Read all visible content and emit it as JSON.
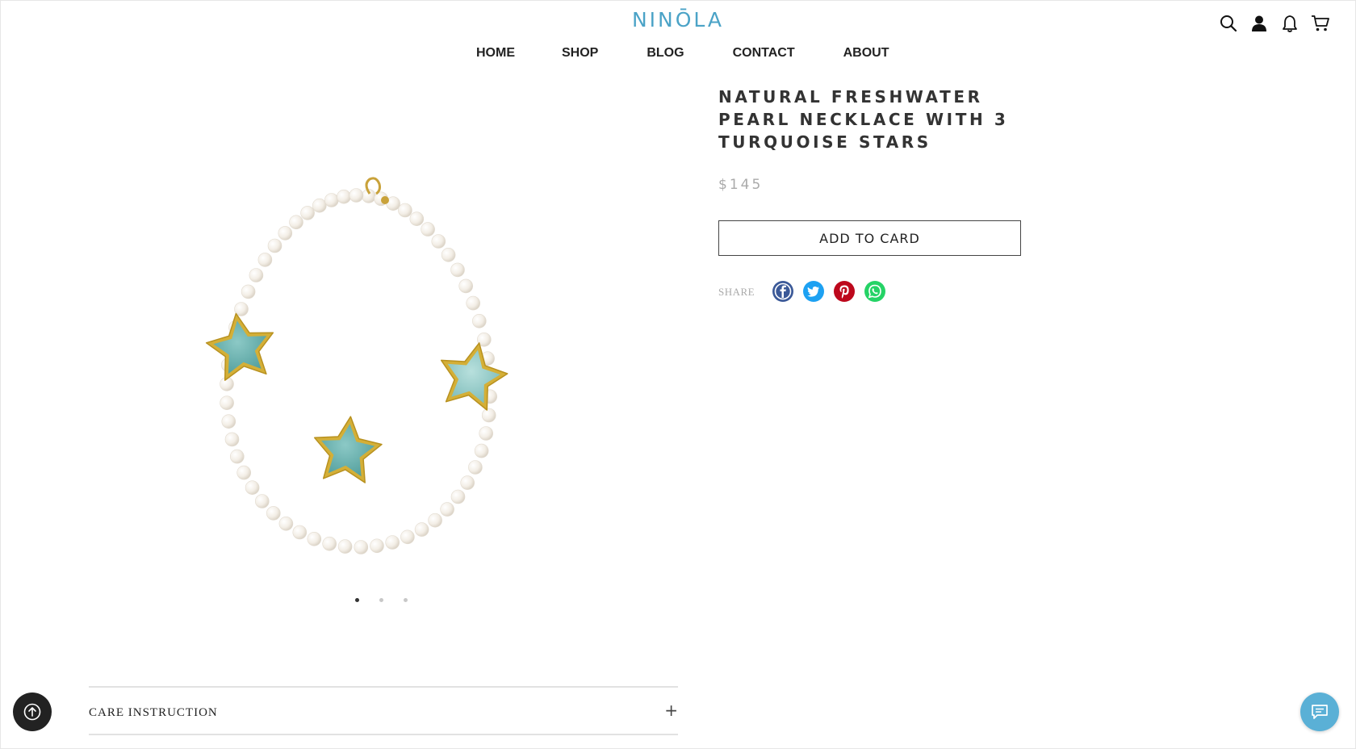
{
  "brand": {
    "logo_text": "NINŌLA",
    "logo_color": "#4ba3c7"
  },
  "nav": {
    "items": [
      {
        "label": "HOME"
      },
      {
        "label": "SHOP"
      },
      {
        "label": "BLOG"
      },
      {
        "label": "CONTACT"
      },
      {
        "label": "ABOUT"
      }
    ]
  },
  "header_icons": [
    "search-icon",
    "user-icon",
    "bell-icon",
    "cart-icon"
  ],
  "product": {
    "title": "NATURAL FRESHWATER PEARL NECKLACE WITH 3 TURQUOISE STARS",
    "price": "$145",
    "add_to_cart_label": "ADD TO CARD",
    "image_count": 3,
    "active_image": 1
  },
  "share": {
    "label": "SHARE",
    "networks": [
      {
        "name": "facebook",
        "color": "#3b5998"
      },
      {
        "name": "twitter",
        "color": "#1da1f2"
      },
      {
        "name": "pinterest",
        "color": "#bd081c"
      },
      {
        "name": "whatsapp",
        "color": "#25d366"
      }
    ]
  },
  "care": {
    "label": "CARE INSTRUCTION",
    "toggle_symbol": "+"
  },
  "colors": {
    "accent": "#4ba3c7",
    "chat_button": "#5ab0d6",
    "scroll_button": "#222222"
  }
}
